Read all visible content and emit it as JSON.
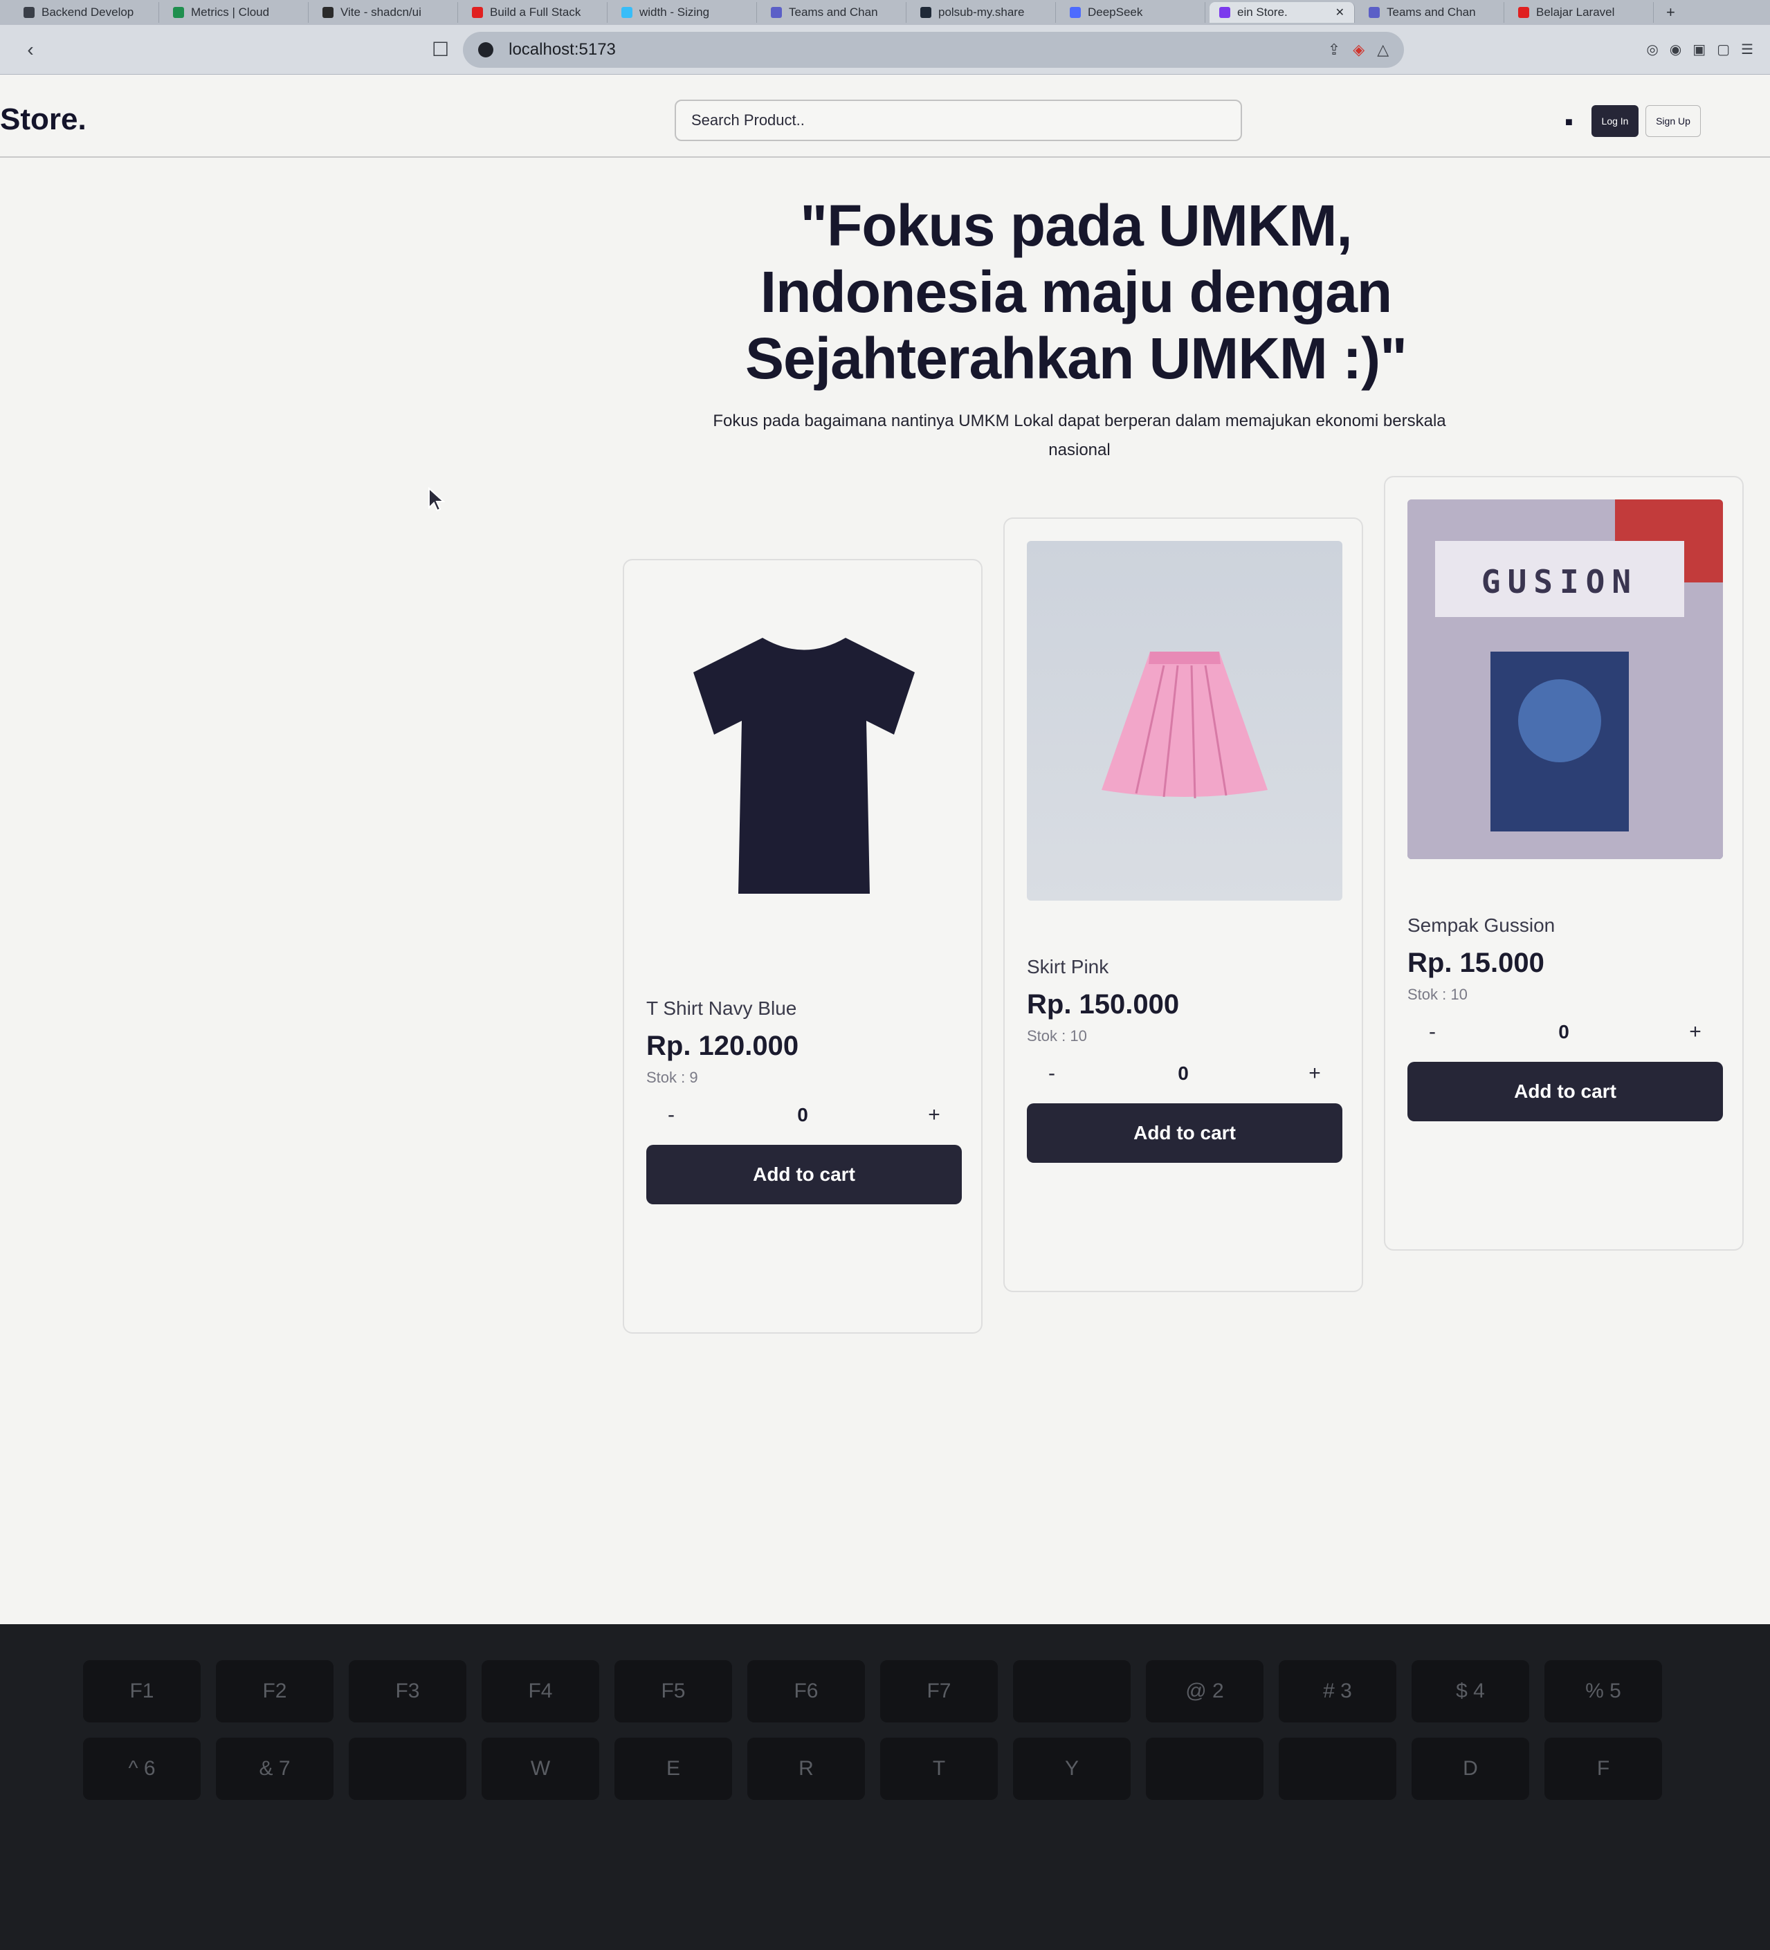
{
  "browser": {
    "tabs": [
      {
        "label": "Backend Develop",
        "color": "#3a3f48",
        "active": false
      },
      {
        "label": "Metrics | Cloud",
        "color": "#1f8f4e",
        "active": false
      },
      {
        "label": "Vite - shadcn/ui",
        "color": "#2b2b2b",
        "active": false
      },
      {
        "label": "Build a Full Stack",
        "color": "#e02020",
        "active": false
      },
      {
        "label": "width - Sizing",
        "color": "#38bdf8",
        "active": false
      },
      {
        "label": "Teams and Chan",
        "color": "#5b5fc7",
        "active": false
      },
      {
        "label": "polsub-my.share",
        "color": "#1f2937",
        "active": false
      },
      {
        "label": "DeepSeek",
        "color": "#4d6bfe",
        "active": false
      },
      {
        "label": "ein Store.",
        "color": "#7c3aed",
        "active": true
      },
      {
        "label": "Teams and Chan",
        "color": "#5b5fc7",
        "active": false
      },
      {
        "label": "Belajar Laravel",
        "color": "#e02020",
        "active": false
      }
    ],
    "url": "localhost:5173"
  },
  "navbar": {
    "logo": "Store.",
    "search_placeholder": "Search Product..",
    "login_label": "Log In",
    "signup_label": "Sign Up",
    "cart_icon": "cart-icon"
  },
  "hero": {
    "title": "\"Fokus pada UMKM, Indonesia maju dengan Sejahterahkan UMKM :)\"",
    "subtitle": "Fokus pada bagaimana nantinya UMKM Lokal dapat berperan dalam memajukan ekonomi berskala nasional"
  },
  "products": [
    {
      "name": "T Shirt Navy Blue",
      "price": "Rp. 120.000",
      "stock": "Stok : 9",
      "qty": "0",
      "minus": "-",
      "plus": "+",
      "button": "Add to cart",
      "image": "navy-tshirt"
    },
    {
      "name": "Skirt Pink",
      "price": "Rp. 150.000",
      "stock": "Stok : 10",
      "qty": "0",
      "minus": "-",
      "plus": "+",
      "button": "Add to cart",
      "image": "pink-skirt"
    },
    {
      "name": "Sempak Gussion",
      "price": "Rp. 15.000",
      "stock": "Stok : 10",
      "qty": "0",
      "minus": "-",
      "plus": "+",
      "button": "Add to cart",
      "image": "gusion-print",
      "image_text": "GUSION"
    }
  ],
  "colors": {
    "primary": "#262637",
    "page_bg": "#f4f4f2",
    "text": "#14142b"
  },
  "keyboard": {
    "keys": [
      "F1",
      "F2",
      "F3",
      "F4",
      "F5",
      "F6",
      "F7",
      "",
      "@ 2",
      "# 3",
      "$ 4",
      "% 5",
      "^ 6",
      "& 7",
      "",
      "W",
      "E",
      "R",
      "T",
      "Y",
      "",
      "",
      "D",
      "F"
    ]
  }
}
